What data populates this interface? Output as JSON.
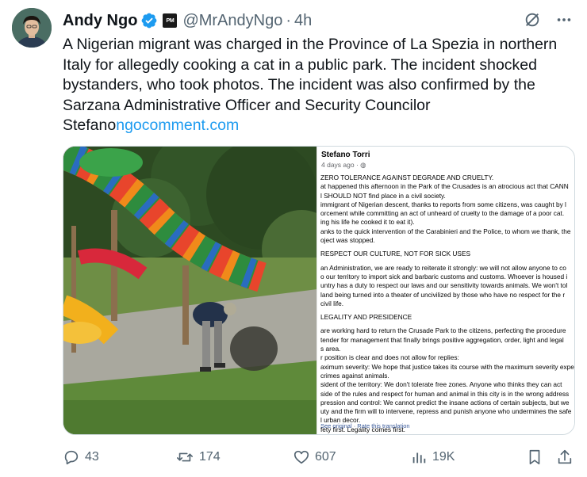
{
  "author": {
    "name": "Andy Ngo",
    "handle": "@MrAndyNgo",
    "affiliate_badge": "PM",
    "time": "4h",
    "verified": true,
    "verified_color": "#1d9bf0"
  },
  "tweet": {
    "lines": [
      "A Nigerian migrant was charged in the Province of La Spezia in northern",
      "Italy for allegedly cooking a cat in a public park. The incident shocked",
      "bystanders, who took photos. The incident was also confirmed by the",
      "Sarzana Administrative Officer and Security Councilor"
    ],
    "last_line_prefix": "Stefano",
    "link_text": "ngocomment.com",
    "link_color": "#1d9bf0"
  },
  "screenshot_post": {
    "author": "Stefano Torri",
    "meta": "4 days ago · ",
    "body": [
      "ZERO TOLERANCE AGAINST DEGRADE AND CRUELTY.",
      "at happened this afternoon in the Park of the Crusades is an atrocious act that CANN",
      "l SHOULD NOT find place in a civil society.",
      "immigrant of Nigerian descent, thanks to reports from some citizens, was caught by l",
      "orcement while committing an act of unheard of cruelty to the damage of a poor cat.",
      "ing his life he cooked it to eat it).",
      "anks to the quick intervention of the Carabinieri and the Police, to whom we thank, the",
      "oject was stopped."
    ],
    "heading_culture": "RESPECT OUR CULTURE, NOT FOR SICK USES",
    "body_culture": [
      "an Administration, we are ready to reiterate it strongly: we will not allow anyone to co",
      "o our territory to import sick and barbaric customs and customs. Whoever is housed i",
      "untry has a duty to respect our laws and our sensitivity towards animals. We won't tol",
      "land being turned into a theater of uncivilized by those who have no respect for the r",
      "civil life."
    ],
    "heading_legality": "LEGALITY AND PRESIDENCE",
    "body_legality": [
      "are working hard to return the Crusade Park to the citizens, perfecting the procedure",
      "tender for management that finally brings positive aggregation, order, light and legal",
      "s area.",
      "r position is clear and does not allow for replies:",
      "aximum severity: We hope that justice takes its course with the maximum severity expe",
      "crimes against animals.",
      "sident of the territory: We don't tolerate free zones. Anyone who thinks they can act",
      "side of the rules and respect for human and animal in this city is in the wrong address",
      "pression and control: We cannot predict the insane actions of certain subjects, but we",
      "uty and the firm will to intervene, repress and punish anyone who undermines the safe",
      "l urban decor.",
      "fety first. Legality comes first."
    ],
    "footer": "See original · Rate this translation"
  },
  "actions": {
    "replies": "43",
    "reposts": "174",
    "likes": "607",
    "views": "19K"
  },
  "icons": [
    "verified-badge-icon",
    "grok-icon",
    "more-icon",
    "reply-icon",
    "repost-icon",
    "like-icon",
    "views-icon",
    "bookmark-icon",
    "share-icon",
    "globe-icon"
  ]
}
